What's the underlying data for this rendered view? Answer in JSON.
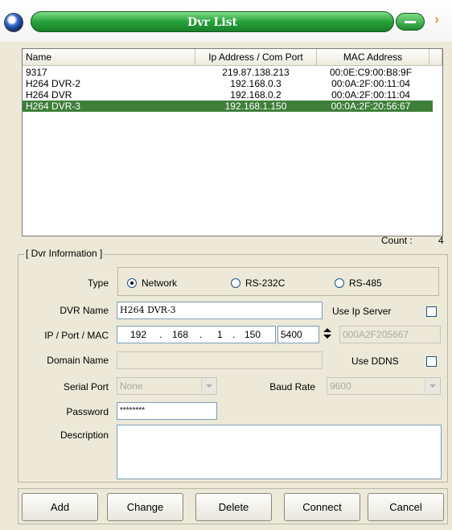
{
  "window": {
    "title": "Dvr List"
  },
  "list": {
    "headers": {
      "name": "Name",
      "ip": "Ip Address / Com Port",
      "mac": "MAC Address"
    },
    "rows": [
      {
        "name": "9317",
        "ip": "219.87.138.213",
        "mac": "00:0E:C9:00:B8:9F"
      },
      {
        "name": "H264 DVR-2",
        "ip": "192.168.0.3",
        "mac": "00:0A:2F:00:11:04"
      },
      {
        "name": "H264 DVR",
        "ip": "192.168.0.2",
        "mac": "00:0A:2F:00:11:04"
      },
      {
        "name": "H264 DVR-3",
        "ip": "192.168.1.150",
        "mac": "00:0A:2F:20:56:67"
      }
    ],
    "selected_index": 3,
    "count_label": "Count :",
    "count_value": "4"
  },
  "info": {
    "group_title": "[ Dvr Information ]",
    "type_label": "Type",
    "type_options": [
      "Network",
      "RS-232C",
      "RS-485"
    ],
    "type_selected": "Network",
    "dvr_name_label": "DVR Name",
    "dvr_name_value": "H264 DVR-3",
    "use_ip_server_label": "Use Ip Server",
    "use_ip_server_checked": false,
    "ip_port_mac_label": "IP / Port / MAC",
    "ip_octets": [
      "192",
      "168",
      "1",
      "150"
    ],
    "ip_dots": ".",
    "port_value": "5400",
    "mac_value": "000A2F205667",
    "domain_name_label": "Domain Name",
    "domain_name_value": "",
    "use_ddns_label": "Use DDNS",
    "use_ddns_checked": false,
    "serial_port_label": "Serial Port",
    "serial_port_value": "None",
    "baud_rate_label": "Baud Rate",
    "baud_rate_value": "9600",
    "password_label": "Password",
    "password_value": "********",
    "description_label": "Description",
    "description_value": ""
  },
  "buttons": {
    "add": "Add",
    "change": "Change",
    "delete": "Delete",
    "connect": "Connect",
    "cancel": "Cancel"
  },
  "colors": {
    "title_green": "#27a239",
    "selection_green": "#3e7f3a",
    "dialog_bg": "#ece9d8"
  }
}
